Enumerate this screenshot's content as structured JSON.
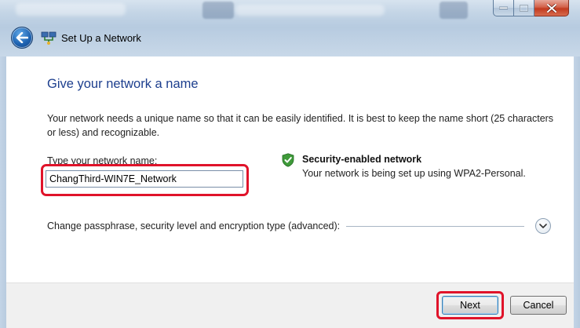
{
  "window": {
    "title": "Set Up a Network",
    "caption_buttons": [
      "minimize",
      "maximize",
      "close"
    ],
    "accent_color": "#1d3f8e",
    "highlight_color": "#e0132a"
  },
  "content": {
    "heading": "Give your network a name",
    "description": "Your network needs a unique name so that it can be easily identified. It is best to keep the name short (25 characters or less) and recognizable.",
    "name_label_prefix": "T",
    "name_label_rest": "ype your network name:",
    "name_value": "ChangThird-WIN7E_Network",
    "security_title": "Security-enabled network",
    "security_text": "Your network is being set up using WPA2-Personal.",
    "advanced_label": "Change passphrase, security level and encryption type (advanced):"
  },
  "footer": {
    "next_label": "Next",
    "cancel_label": "Cancel"
  },
  "icons": {
    "back": "back-arrow-icon",
    "network": "network-setup-icon",
    "security": "shield-check-icon",
    "expand": "chevron-down-icon"
  }
}
